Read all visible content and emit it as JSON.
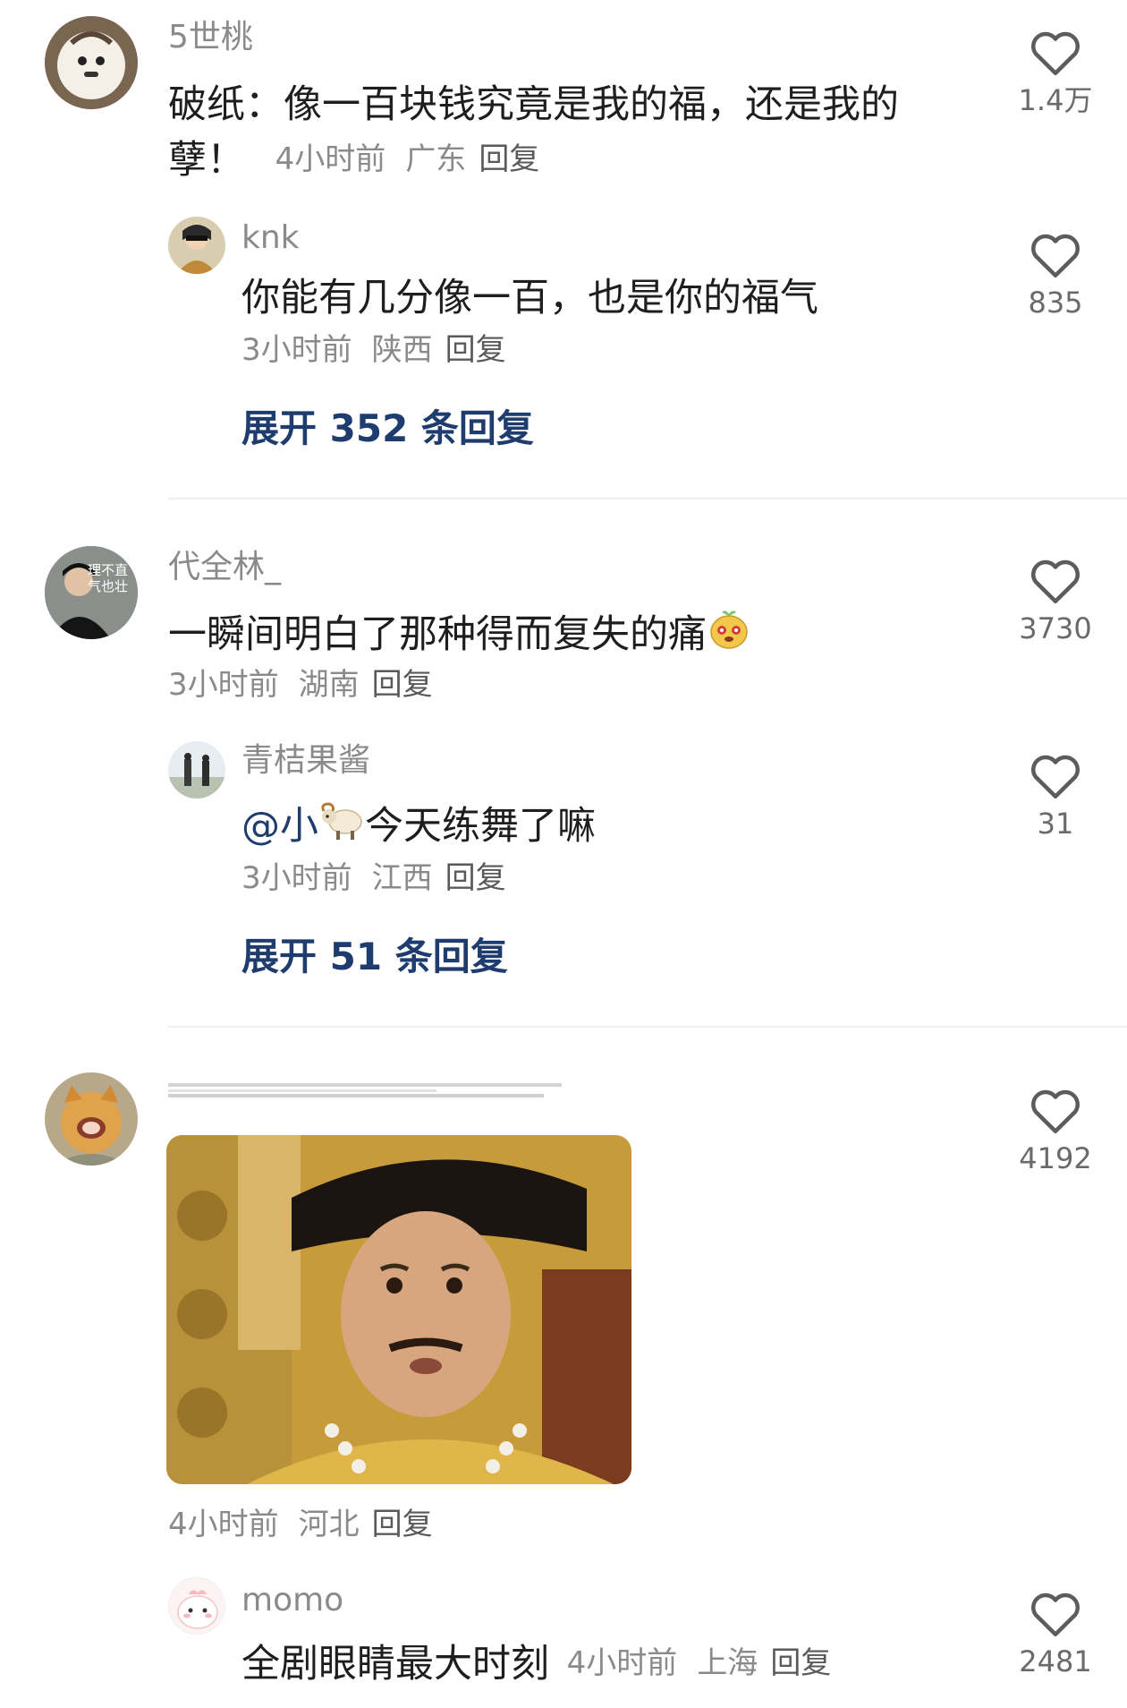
{
  "comments": [
    {
      "user": "5世桃",
      "text_line1": "破纸：像一百块钱究竟是我的福，还是我的",
      "text_line2": "孽！",
      "time": "4小时前",
      "location": "广东",
      "reply_label": "回复",
      "likes": "1.4万",
      "reply": {
        "user": "knk",
        "text": "你能有几分像一百，也是你的福气",
        "time": "3小时前",
        "location": "陕西",
        "reply_label": "回复",
        "likes": "835"
      },
      "expand_label": "展开 352 条回复"
    },
    {
      "user": "代全林_",
      "text": "一瞬间明白了那种得而复失的痛",
      "time": "3小时前",
      "location": "湖南",
      "reply_label": "回复",
      "likes": "3730",
      "avatar_text": "理不直 气也壮",
      "reply": {
        "user": "青桔果酱",
        "text_before": "@小",
        "text_after": "今天练舞了嘛",
        "time": "3小时前",
        "location": "江西",
        "reply_label": "回复",
        "likes": "31"
      },
      "expand_label": "展开 51 条回复"
    },
    {
      "user": "",
      "time": "4小时前",
      "location": "河北",
      "reply_label": "回复",
      "likes": "4192",
      "image_icon": "meme-photo-qing-official",
      "reply": {
        "user": "momo",
        "text": "全剧眼睛最大时刻",
        "time": "4小时前",
        "location": "上海",
        "reply_label": "回复",
        "likes": "2481"
      }
    }
  ],
  "icons": {
    "like": "heart-outline-icon",
    "emoji_1": "cute-face-emoji",
    "emoji_2": "sheep-emoji"
  },
  "colors": {
    "expand_link": "#1f3c6e",
    "meta_text": "#8a8a8a",
    "body_text": "#1e1e1e"
  }
}
